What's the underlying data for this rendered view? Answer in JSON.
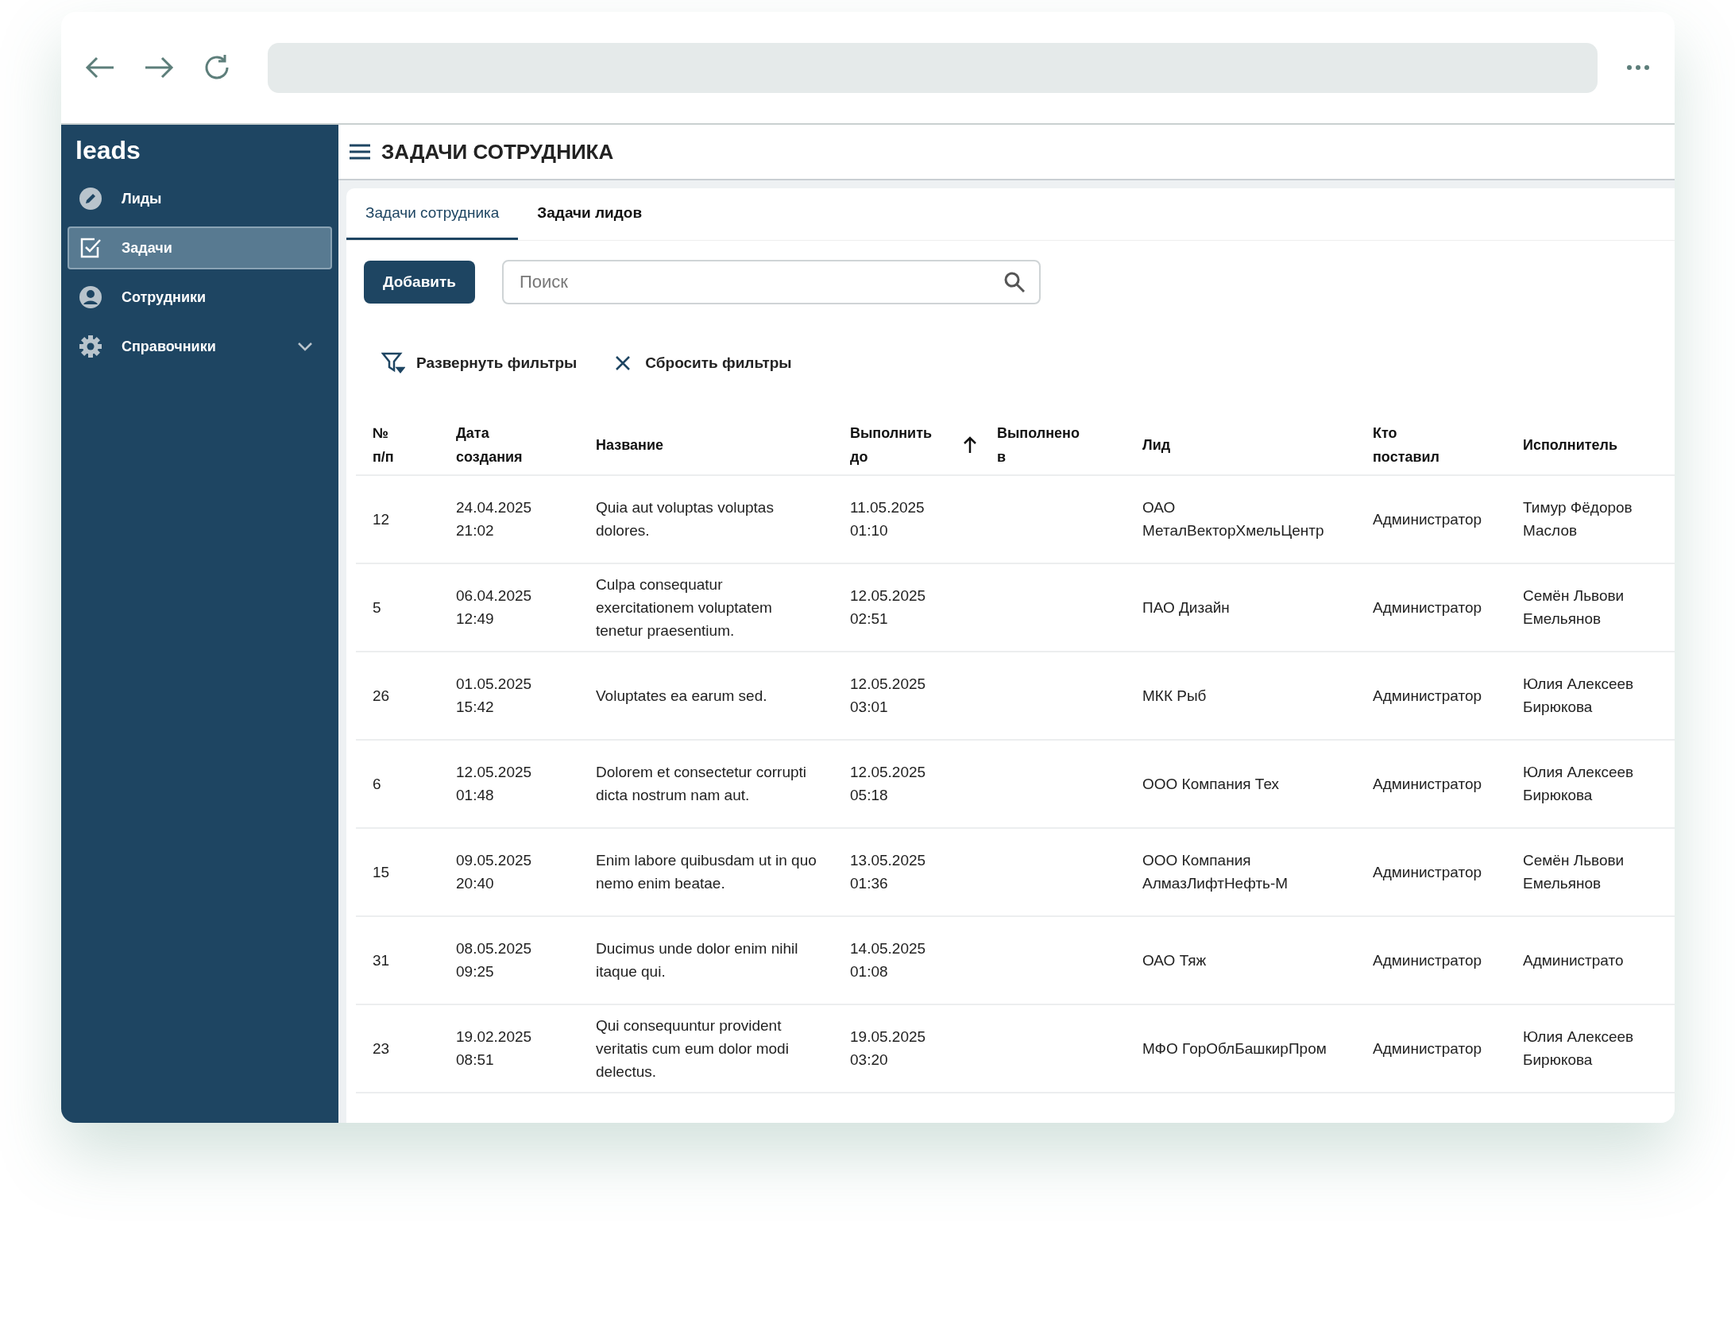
{
  "app": {
    "logo": "leads",
    "page_title": "ЗАДАЧИ СОТРУДНИКА"
  },
  "sidebar": {
    "items": [
      {
        "label": "Лиды",
        "selected": false
      },
      {
        "label": "Задачи",
        "selected": true
      },
      {
        "label": "Сотрудники",
        "selected": false
      },
      {
        "label": "Справочники",
        "selected": false,
        "expanded": false
      }
    ]
  },
  "tabs": [
    {
      "label": "Задачи сотрудника",
      "selected": true
    },
    {
      "label": "Задачи лидов",
      "selected": false
    }
  ],
  "add_button": "Добавить",
  "search": {
    "placeholder": "Поиск"
  },
  "filters": {
    "expand": "Развернуть фильтры",
    "reset": "Сбросить фильтры"
  },
  "table": {
    "columns": [
      {
        "label": "№ п/п"
      },
      {
        "label": "Дата создания"
      },
      {
        "label": "Название"
      },
      {
        "label": "Выполнить до",
        "sorted": true
      },
      {
        "label": "Выполнено в"
      },
      {
        "label": "Лид"
      },
      {
        "label": "Кто поставил"
      },
      {
        "label": "Исполнитель"
      }
    ],
    "rows": [
      [
        "12",
        "24.04.2025 21:02",
        "Quia aut voluptas voluptas dolores.",
        "11.05.2025 01:10",
        "",
        "ОАО МеталВекторХмельЦентр",
        "Администратор",
        "Тимур Фёдоров Маслов"
      ],
      [
        "5",
        "06.04.2025 12:49",
        "Culpa consequatur exercitationem voluptatem tenetur praesentium.",
        "12.05.2025 02:51",
        "",
        "ПАО Дизайн",
        "Администратор",
        "Семён Львови Емельянов"
      ],
      [
        "26",
        "01.05.2025 15:42",
        "Voluptates ea earum sed.",
        "12.05.2025 03:01",
        "",
        "МКК Рыб",
        "Администратор",
        "Юлия Алексеев Бирюкова"
      ],
      [
        "6",
        "12.05.2025 01:48",
        "Dolorem et consectetur corrupti dicta nostrum nam aut.",
        "12.05.2025 05:18",
        "",
        "ООО Компания Тех",
        "Администратор",
        "Юлия Алексеев Бирюкова"
      ],
      [
        "15",
        "09.05.2025 20:40",
        "Enim labore quibusdam ut in quo nemo enim beatae.",
        "13.05.2025 01:36",
        "",
        "ООО Компания АлмазЛифтНефть-М",
        "Администратор",
        "Семён Львови Емельянов"
      ],
      [
        "31",
        "08.05.2025 09:25",
        "Ducimus unde dolor enim nihil itaque qui.",
        "14.05.2025 01:08",
        "",
        "ОАО Тяж",
        "Администратор",
        "Администрато"
      ],
      [
        "23",
        "19.02.2025 08:51",
        "Qui consequuntur provident veritatis cum eum dolor modi delectus.",
        "19.05.2025 03:20",
        "",
        "МФО ГорОблБашкирПром",
        "Администратор",
        "Юлия Алексеев Бирюкова"
      ]
    ]
  }
}
